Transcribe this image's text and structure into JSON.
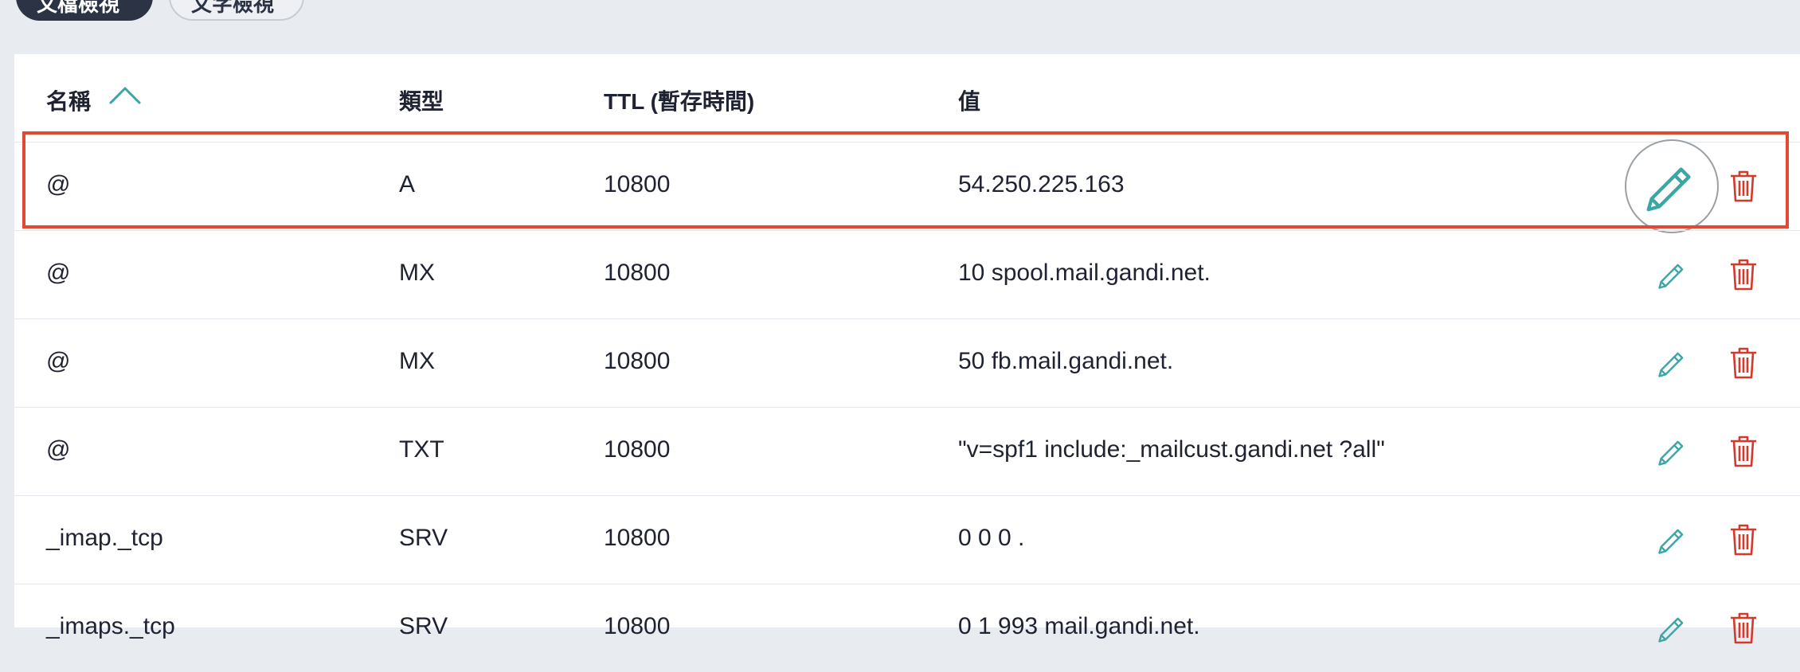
{
  "view_toggle": {
    "active_label": "文檔檢視",
    "inactive_label": "文字檢視"
  },
  "table": {
    "headers": {
      "name": "名稱",
      "type": "類型",
      "ttl": "TTL (暫存時間)",
      "value": "值"
    },
    "sort": {
      "column": "name",
      "direction": "ascending",
      "icon": "chevron-up-icon"
    },
    "rows": [
      {
        "name": "@",
        "type": "A",
        "ttl": "10800",
        "value": "54.250.225.163",
        "highlighted": true
      },
      {
        "name": "@",
        "type": "MX",
        "ttl": "10800",
        "value": "10 spool.mail.gandi.net."
      },
      {
        "name": "@",
        "type": "MX",
        "ttl": "10800",
        "value": "50 fb.mail.gandi.net."
      },
      {
        "name": "@",
        "type": "TXT",
        "ttl": "10800",
        "value": "\"v=spf1 include:_mailcust.gandi.net ?all\""
      },
      {
        "name": "_imap._tcp",
        "type": "SRV",
        "ttl": "10800",
        "value": "0 0 0 ."
      },
      {
        "name": "_imaps._tcp",
        "type": "SRV",
        "ttl": "10800",
        "value": "0 1 993 mail.gandi.net."
      }
    ],
    "row_actions": {
      "edit_icon": "pencil-icon",
      "delete_icon": "trash-icon"
    }
  },
  "colors": {
    "accent_teal": "#3aa6a6",
    "delete_red": "#d33a2c",
    "highlight_border": "#e04a34",
    "dark_button": "#2b3345",
    "page_bg": "#e8ebef"
  }
}
